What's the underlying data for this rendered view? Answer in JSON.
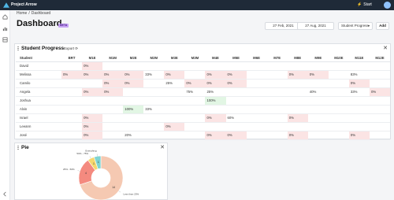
{
  "app": {
    "title": "Project Arrow",
    "start_label": "Start"
  },
  "breadcrumb": [
    "Home",
    "/",
    "Dashboard"
  ],
  "page": {
    "title": "Dashboard",
    "badge": "BETA"
  },
  "filters": {
    "start_date": "27 Feb, 2021",
    "separator": "-",
    "end_date": "27 Aug, 2021",
    "select_value": "Student Progress",
    "add_label": "Add"
  },
  "progress": {
    "title": "Student Progress",
    "export_label": "Export",
    "columns": [
      "Student",
      "BRT",
      "M1E",
      "M1M",
      "M2E",
      "M2M",
      "M3E",
      "M3M",
      "M4E",
      "M5E",
      "M6E",
      "M7E",
      "M8E",
      "M9E",
      "M10E",
      "M11E",
      "M12E"
    ],
    "rows": [
      {
        "name": "David",
        "cells": [
          {},
          {
            "v": "0%",
            "c": "red"
          },
          {},
          {},
          {},
          {},
          {},
          {},
          {},
          {},
          {},
          {},
          {},
          {},
          {},
          {}
        ]
      },
      {
        "name": "Melissa",
        "cells": [
          {
            "v": "0%",
            "c": "red"
          },
          {
            "v": "0%",
            "c": "red"
          },
          {
            "v": "0%",
            "c": "red"
          },
          {
            "v": "0%",
            "c": "red"
          },
          {
            "v": "33%"
          },
          {
            "v": "0%",
            "c": "red"
          },
          {},
          {
            "v": "0%",
            "c": "red"
          },
          {
            "v": "0%",
            "c": "red"
          },
          {},
          {},
          {
            "v": "0%",
            "c": "red"
          },
          {
            "v": "0%",
            "c": "red"
          },
          {},
          {
            "v": "83%"
          },
          {}
        ]
      },
      {
        "name": "Camilo",
        "cells": [
          {},
          {},
          {
            "v": "0%",
            "c": "red"
          },
          {
            "v": "0%",
            "c": "red"
          },
          {},
          {
            "v": "25%"
          },
          {
            "v": "0%",
            "c": "red"
          },
          {
            "v": "0%",
            "c": "red"
          },
          {
            "v": "0%",
            "c": "red"
          },
          {},
          {},
          {},
          {},
          {},
          {
            "v": "0%",
            "c": "red"
          },
          {}
        ]
      },
      {
        "name": "Angela",
        "cells": [
          {},
          {
            "v": "0%",
            "c": "red"
          },
          {
            "v": "0%",
            "c": "red"
          },
          {},
          {},
          {},
          {
            "v": "75%"
          },
          {
            "v": "25%"
          },
          {},
          {},
          {},
          {},
          {
            "v": "40%"
          },
          {},
          {
            "v": "33%"
          },
          {
            "v": "0%",
            "c": "red"
          }
        ]
      },
      {
        "name": "Joshua",
        "cells": [
          {},
          {},
          {},
          {},
          {},
          {},
          {},
          {
            "v": "100%",
            "c": "green"
          },
          {},
          {},
          {},
          {},
          {},
          {},
          {},
          {}
        ]
      },
      {
        "name": "Alvin",
        "cells": [
          {},
          {},
          {},
          {
            "v": "100%",
            "c": "green"
          },
          {
            "v": "33%"
          },
          {},
          {},
          {},
          {},
          {},
          {},
          {},
          {},
          {},
          {},
          {}
        ]
      },
      {
        "name": "Israel",
        "cells": [
          {},
          {
            "v": "0%",
            "c": "red"
          },
          {},
          {},
          {},
          {},
          {},
          {
            "v": "0%",
            "c": "red"
          },
          {
            "v": "60%"
          },
          {},
          {},
          {
            "v": "0%",
            "c": "red"
          },
          {},
          {},
          {},
          {}
        ]
      },
      {
        "name": "Leeann",
        "cells": [
          {},
          {
            "v": "0%",
            "c": "red"
          },
          {},
          {},
          {},
          {
            "v": "0%",
            "c": "red"
          },
          {},
          {},
          {},
          {},
          {},
          {},
          {},
          {},
          {},
          {}
        ]
      },
      {
        "name": "José",
        "cells": [
          {},
          {
            "v": "0%",
            "c": "red"
          },
          {},
          {
            "v": "20%"
          },
          {},
          {},
          {},
          {
            "v": "0%",
            "c": "red"
          },
          {
            "v": "0%",
            "c": "red"
          },
          {},
          {},
          {
            "v": "0%",
            "c": "red"
          },
          {},
          {},
          {
            "v": "0%",
            "c": "red"
          },
          {}
        ]
      }
    ]
  },
  "pie": {
    "title": "Pie",
    "chart_data": {
      "type": "pie",
      "title": "",
      "slices": [
        {
          "label": "Less than 25%",
          "value": 14,
          "color": "#f5c9b2"
        },
        {
          "label": "25% - 50%",
          "value": 4,
          "color": "#f48a7f"
        },
        {
          "label": "50% - 75%",
          "value": 1,
          "color": "#f5d76e"
        },
        {
          "label": "Everything",
          "value": 1,
          "color": "#7fd4d1"
        }
      ]
    }
  }
}
